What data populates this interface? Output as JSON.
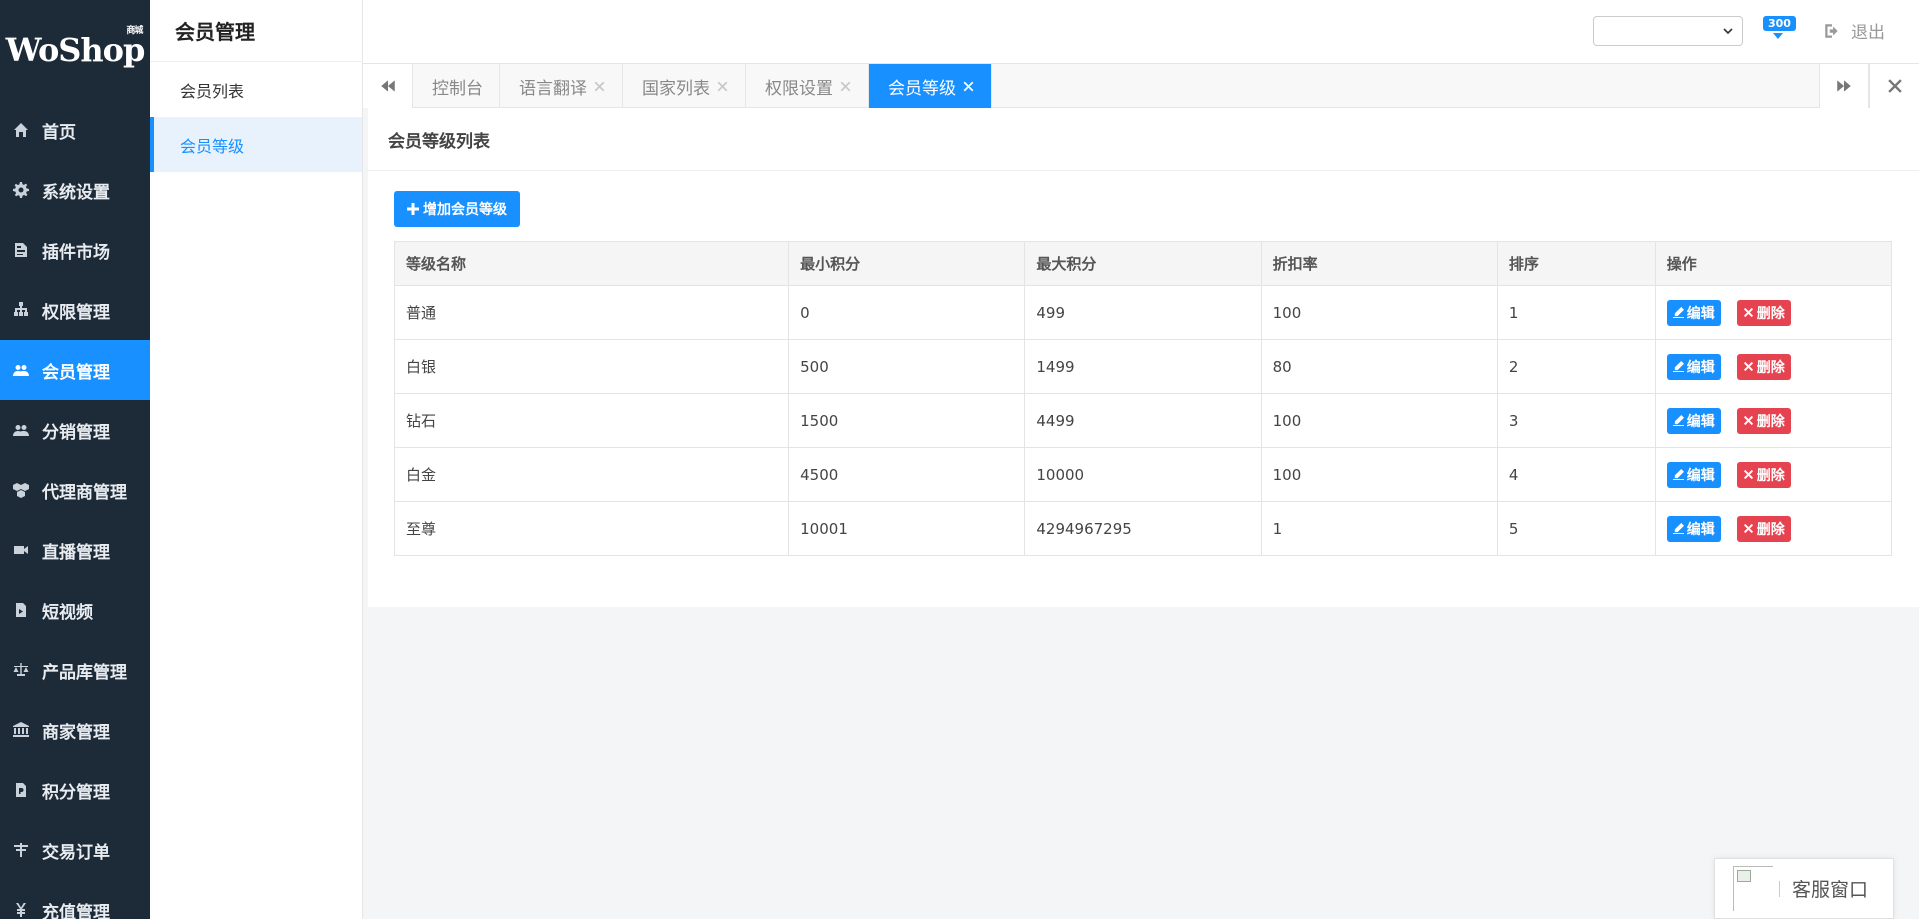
{
  "brand": {
    "logo_text": "WoShop",
    "logo_sub": "商城"
  },
  "sidebar": {
    "items": [
      {
        "label": "首页",
        "icon": "home-icon"
      },
      {
        "label": "系统设置",
        "icon": "gear-icon"
      },
      {
        "label": "插件市场",
        "icon": "plugin-icon"
      },
      {
        "label": "权限管理",
        "icon": "sitemap-icon"
      },
      {
        "label": "会员管理",
        "icon": "users-icon",
        "active": true
      },
      {
        "label": "分销管理",
        "icon": "users-icon"
      },
      {
        "label": "代理商管理",
        "icon": "cubes-icon"
      },
      {
        "label": "直播管理",
        "icon": "video-camera-icon"
      },
      {
        "label": "短视频",
        "icon": "file-video-icon"
      },
      {
        "label": "产品库管理",
        "icon": "balance-scale-icon"
      },
      {
        "label": "商家管理",
        "icon": "bank-icon"
      },
      {
        "label": "积分管理",
        "icon": "file-points-icon"
      },
      {
        "label": "交易订单",
        "icon": "order-icon"
      },
      {
        "label": "充值管理",
        "icon": "yen-icon"
      }
    ]
  },
  "submenu": {
    "title": "会员管理",
    "items": [
      {
        "label": "会员列表"
      },
      {
        "label": "会员等级",
        "active": true
      }
    ]
  },
  "topbar": {
    "select_value": "",
    "message_count": "300",
    "logout_label": "退出"
  },
  "tabs": [
    {
      "label": "控制台",
      "closable": false
    },
    {
      "label": "语言翻译",
      "closable": true
    },
    {
      "label": "国家列表",
      "closable": true
    },
    {
      "label": "权限设置",
      "closable": true
    },
    {
      "label": "会员等级",
      "closable": true,
      "active": true
    }
  ],
  "panel": {
    "title": "会员等级列表",
    "add_button": "增加会员等级",
    "columns": [
      "等级名称",
      "最小积分",
      "最大积分",
      "折扣率",
      "排序",
      "操作"
    ],
    "rows": [
      [
        "普通",
        "0",
        "499",
        "100",
        "1"
      ],
      [
        "白银",
        "500",
        "1499",
        "80",
        "2"
      ],
      [
        "钻石",
        "1500",
        "4499",
        "100",
        "3"
      ],
      [
        "白金",
        "4500",
        "10000",
        "100",
        "4"
      ],
      [
        "至尊",
        "10001",
        "4294967295",
        "1",
        "5"
      ]
    ],
    "edit_label": "编辑",
    "delete_label": "删除"
  },
  "kefu": {
    "label": "客服窗口"
  },
  "colors": {
    "sidebar_bg": "#1d2b39",
    "accent": "#1890ff",
    "danger": "#e5434f"
  }
}
